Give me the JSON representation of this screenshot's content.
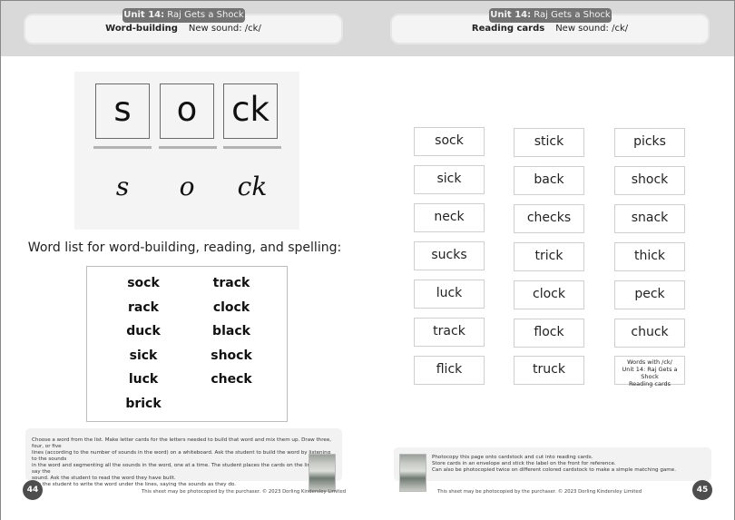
{
  "left_page": {
    "header": {
      "unit_bold": "Unit 14:",
      "unit_title": "Raj Gets a Shock",
      "section": "Word-building",
      "new_sound": "New sound: /ck/"
    },
    "word_building": {
      "letter_cards": [
        "s",
        "o",
        "ck"
      ],
      "written_letters": [
        "s",
        "o",
        "ck"
      ]
    },
    "word_list": {
      "title": "Word list for word-building, reading, and spelling:",
      "column1": [
        "sock",
        "rack",
        "duck",
        "sick",
        "luck",
        "brick"
      ],
      "column2": [
        "track",
        "clock",
        "black",
        "shock",
        "check"
      ]
    },
    "instructions": [
      "Choose a word from the list. Make letter cards for the letters needed to build that word and mix them up. Draw three, four, or five",
      "lines (according to the number of sounds in the word) on a whiteboard. Ask the student to build the word by listening to the sounds",
      "in the word and segmenting all the sounds in the word, one at a time. The student places the cards on the line as they say the",
      "sound. Ask the student to read the word they have built.",
      "Ask the student to write the word under the lines, saying the sounds as they do."
    ],
    "page_number": "44",
    "copyright": "This sheet may be photocopied by the purchaser. © 2023 Dorling Kindersley Limited"
  },
  "right_page": {
    "header": {
      "unit_bold": "Unit 14:",
      "unit_title": "Raj Gets a Shock",
      "section": "Reading cards",
      "new_sound": "New sound: /ck/"
    },
    "reading_cards": {
      "column1": [
        "sock",
        "sick",
        "neck",
        "sucks",
        "luck",
        "track",
        "flick"
      ],
      "column2": [
        "stick",
        "back",
        "checks",
        "trick",
        "clock",
        "flock",
        "truck"
      ],
      "column3": [
        "picks",
        "shock",
        "snack",
        "thick",
        "peck",
        "chuck"
      ],
      "label_card": [
        "Words with /ck/",
        "Unit 14: Raj Gets a Shock",
        "Reading cards"
      ]
    },
    "instructions": [
      "Photocopy this page onto cardstock and cut into reading cards.",
      "Store cards in an envelope and stick the label on the front for reference.",
      "Can also be photocopied twice on different colored cardstock to make a simple matching game."
    ],
    "page_number": "45",
    "copyright": "This sheet may be photocopied by the purchaser. © 2023 Dorling Kindersley Limited"
  }
}
